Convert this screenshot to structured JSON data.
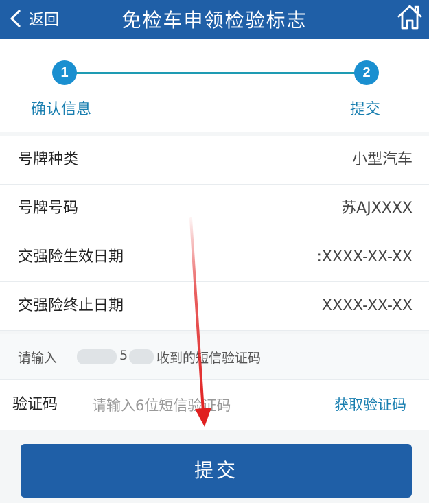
{
  "header": {
    "back_label": "返回",
    "title": "免检车申领检验标志",
    "back_icon": "chevron-left-icon",
    "home_icon": "home-icon"
  },
  "stepper": {
    "steps": [
      {
        "number": "1",
        "label": "确认信息"
      },
      {
        "number": "2",
        "label": "提交"
      }
    ]
  },
  "info": {
    "rows": [
      {
        "label": "号牌种类",
        "value": "小型汽车"
      },
      {
        "label": "号牌号码",
        "value": "苏AJXXXX"
      },
      {
        "label": "交强险生效日期",
        "value": ":XXXX-XX-XX"
      },
      {
        "label": "交强险终止日期",
        "value": "XXXX-XX-XX"
      }
    ]
  },
  "sms_hint": {
    "part1": "请输入",
    "part2": "5",
    "part3": "收到的短信验证码"
  },
  "code_row": {
    "label": "验证码",
    "placeholder": "请输入6位短信验证码",
    "get_code_label": "获取验证码"
  },
  "submit": {
    "label": "提交"
  },
  "colors": {
    "brand": "#1f5fa7",
    "accent": "#1a8fd0",
    "annotation_arrow": "#e02020"
  }
}
